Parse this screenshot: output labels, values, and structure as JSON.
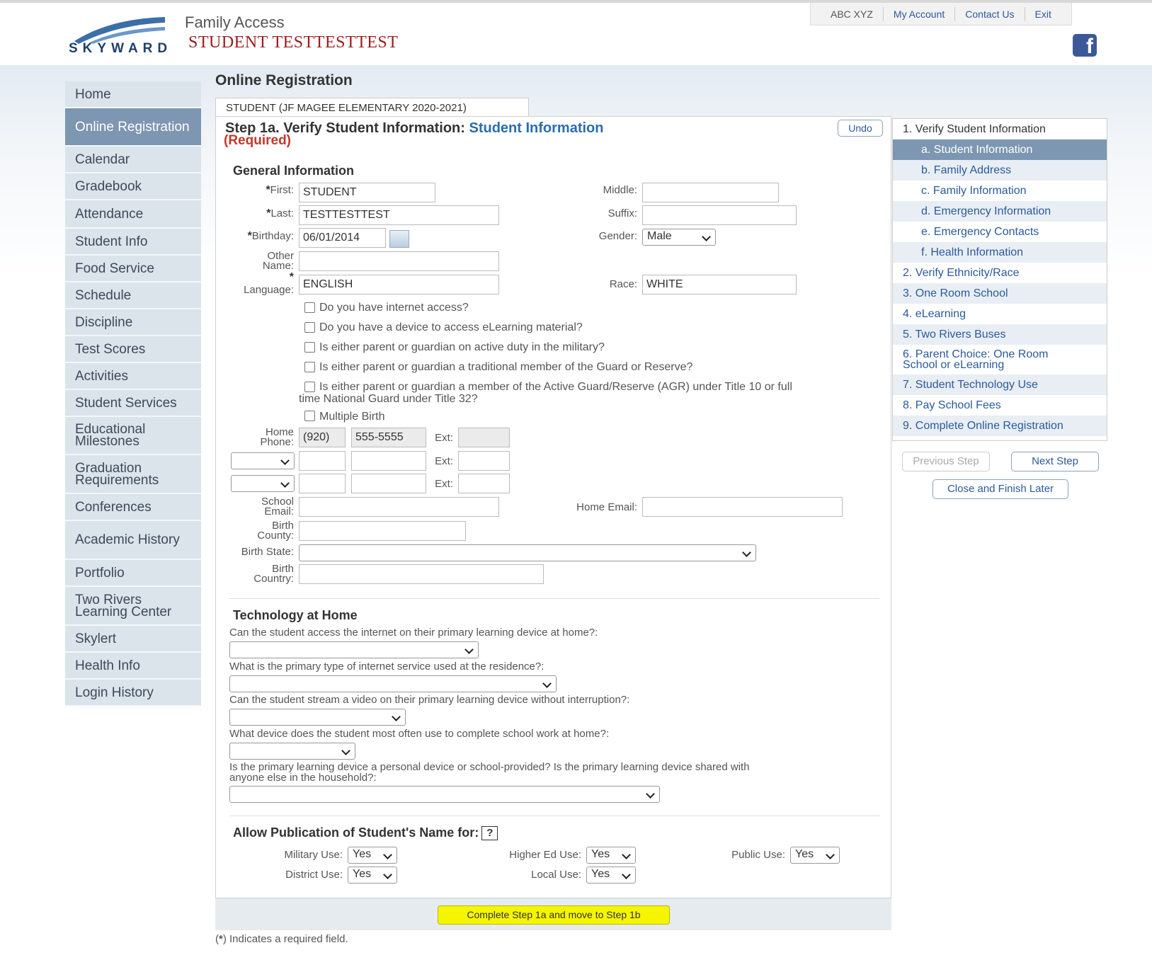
{
  "header": {
    "brand": "SKYWARD",
    "app_name": "Family Access",
    "student_name": "STUDENT TESTTESTTEST",
    "user": "ABC XYZ",
    "my_account": "My Account",
    "contact_us": "Contact Us",
    "exit": "Exit",
    "facebook": "f"
  },
  "nav": [
    "Home",
    "Online Registration",
    "Calendar",
    "Gradebook",
    "Attendance",
    "Student Info",
    "Food Service",
    "Schedule",
    "Discipline",
    "Test Scores",
    "Activities",
    "Student Services",
    "Educational Milestones",
    "Graduation Requirements",
    "Conferences",
    "Academic History",
    "Portfolio",
    "Two Rivers Learning Center",
    "Skylert",
    "Health Info",
    "Login History"
  ],
  "page": {
    "title": "Online Registration",
    "tab": "STUDENT (JF MAGEE ELEMENTARY 2020-2021)",
    "step_prefix": "Step 1a. Verify Student Information:",
    "step_name": "Student Information",
    "required": "(Required)",
    "undo": "Undo"
  },
  "general": {
    "heading": "General Information",
    "first_label": "First:",
    "first_value": "STUDENT",
    "middle_label": "Middle:",
    "middle_value": "",
    "last_label": "Last:",
    "last_value": "TESTTESTTEST",
    "suffix_label": "Suffix:",
    "suffix_value": "",
    "birthday_label": "Birthday:",
    "birthday_value": "06/01/2014",
    "gender_label": "Gender:",
    "gender_value": "Male",
    "other_name_label_1": "Other",
    "other_name_label_2": "Name:",
    "language_label": "Language:",
    "language_value": "ENGLISH",
    "race_label": "Race:",
    "race_value": "WHITE",
    "asterisk": "*",
    "checks": [
      "Do you have internet access?",
      "Do you have a device to access eLearning material?",
      "Is either parent or guardian on active duty in the military?",
      "Is either parent or guardian a traditional member of the Guard or Reserve?",
      "Is either parent or guardian a member of the Active Guard/Reserve (AGR) under Title 10 or full",
      "time National Guard under Title 32?",
      "Multiple Birth"
    ],
    "home_phone_label_1": "Home",
    "home_phone_label_2": "Phone:",
    "area_code": "(920)",
    "phone_number": "555-5555",
    "ext_label": "Ext:",
    "school_email_label_1": "School",
    "school_email_label_2": "Email:",
    "home_email_label": "Home Email:",
    "birth_county_label_1": "Birth",
    "birth_county_label_2": "County:",
    "birth_state_label": "Birth State:",
    "birth_country_label_1": "Birth",
    "birth_country_label_2": "Country:"
  },
  "technology": {
    "heading": "Technology at Home",
    "questions": [
      "Can the student access the internet on their primary learning device at home?:",
      "What is the primary type of internet service used at the residence?:",
      "Can the student stream a video on their primary learning device without interruption?:",
      "What device does the student most often use to complete school work at home?:",
      "Is the primary learning device a personal device or school-provided? Is the primary learning device shared with",
      "anyone else in the household?:"
    ]
  },
  "publication": {
    "heading": "Allow Publication of Student's Name for:",
    "help": "?",
    "military_label": "Military Use:",
    "military_value": "Yes",
    "higher_ed_label": "Higher Ed Use:",
    "higher_ed_value": "Yes",
    "public_label": "Public Use:",
    "public_value": "Yes",
    "district_label": "District Use:",
    "district_value": "Yes",
    "local_label": "Local Use:",
    "local_value": "Yes"
  },
  "footer": {
    "complete_button": "Complete Step 1a and move to Step 1b",
    "required_note_star": "*",
    "required_note": "Indicates a required field."
  },
  "steps": {
    "items": [
      "1. Verify Student Information",
      "a. Student Information",
      "b. Family Address",
      "c. Family Information",
      "d. Emergency Information",
      "e. Emergency Contacts",
      "f. Health Information",
      "2. Verify Ethnicity/Race",
      "3. One Room School",
      "4. eLearning",
      "5. Two Rivers Buses",
      "6. Parent Choice: One Room",
      "School or eLearning",
      "7. Student Technology Use",
      "8. Pay School Fees",
      "9. Complete Online Registration"
    ],
    "previous": "Previous Step",
    "next": "Next Step",
    "close": "Close and Finish Later"
  },
  "colors": {
    "nav_bg": "#dbe3eb",
    "nav_active": "#7d96b1",
    "required_red": "#c0392b",
    "link_blue": "#2b6cb0",
    "highlight": "#f5f500"
  }
}
